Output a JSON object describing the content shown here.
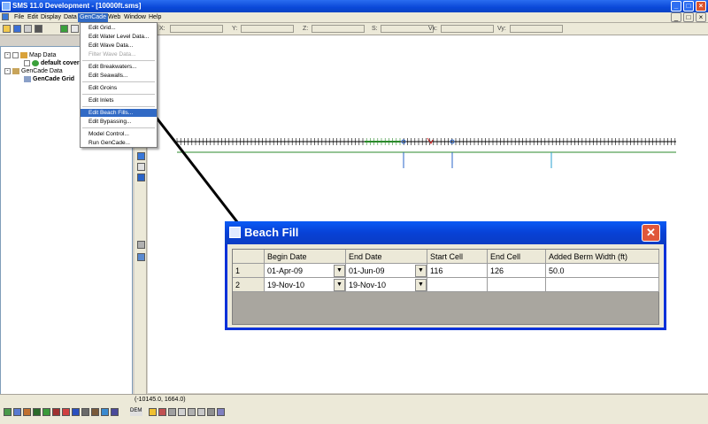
{
  "window": {
    "title": "SMS 11.0 Development - [10000ft.sms]"
  },
  "menubar": [
    "File",
    "Edit",
    "Display",
    "Data",
    "GenCade",
    "Web",
    "Window",
    "Help"
  ],
  "toolbar": {
    "coords": [
      "X:",
      "Y:",
      "Z:",
      "S:",
      "Vx:",
      "Vy:"
    ]
  },
  "tree": {
    "map_data": "Map Data",
    "default_coverage": "default coverage",
    "gencade_data": "GenCade Data",
    "gencade_grid": "GenCade Grid"
  },
  "menu": {
    "items": [
      "Edit Grid...",
      "Edit Water Level Data...",
      "Edit Wave Data...",
      "Filter Wave Data...",
      "Edit Breakwaters...",
      "Edit Seawalls...",
      "Edit Groins",
      "Edit Inlets",
      "Edit Beach Fills...",
      "Edit Bypassing...",
      "Model Control...",
      "Run GenCade..."
    ]
  },
  "dialog": {
    "title": "Beach Fill",
    "columns": [
      "",
      "Begin Date",
      "End Date",
      "Start Cell",
      "End Cell",
      "Added Berm Width (ft)"
    ],
    "rows": [
      [
        "1",
        "01-Apr-09",
        "01-Jun-09",
        "116",
        "126",
        "50.0"
      ],
      [
        "2",
        "19-Nov-10",
        "19-Nov-10",
        "",
        "",
        ""
      ]
    ]
  },
  "status": {
    "coords": "(-10145.0, 1664.0)",
    "dem_label": "DEM"
  },
  "colors": {
    "title_blue": "#0a48d8",
    "highlight": "#316ac5",
    "close_red": "#e0573b",
    "grid_line": "#2b8a2b"
  }
}
